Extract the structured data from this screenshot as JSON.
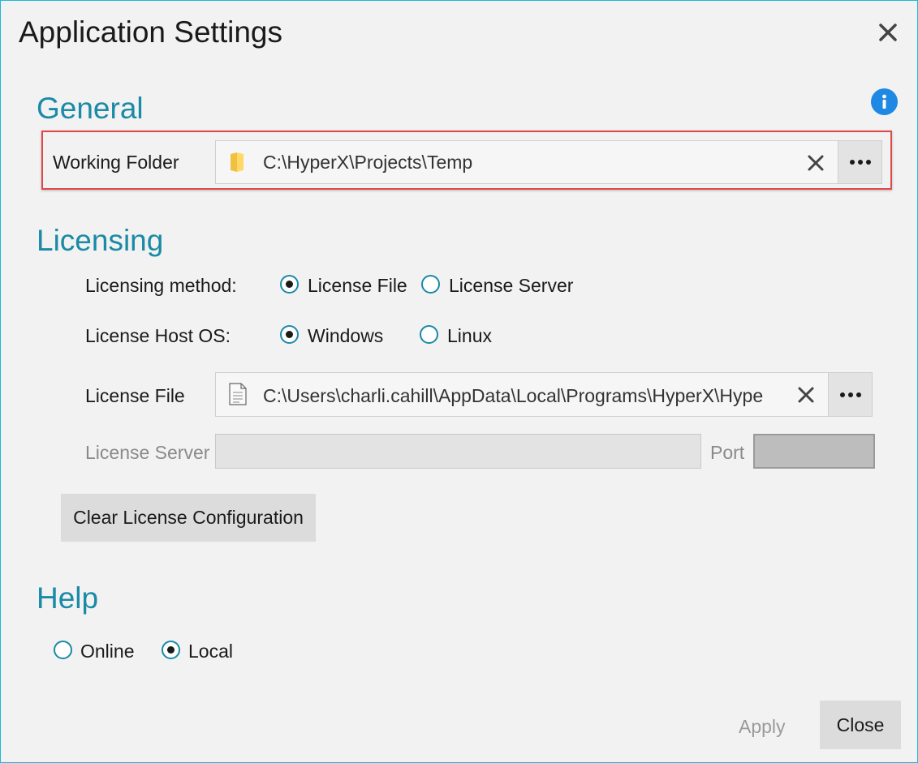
{
  "window": {
    "title": "Application Settings"
  },
  "general": {
    "heading": "General",
    "working_folder": {
      "label": "Working Folder",
      "value": "C:\\HyperX\\Projects\\Temp"
    }
  },
  "licensing": {
    "heading": "Licensing",
    "method": {
      "label": "Licensing method:",
      "options": [
        {
          "label": "License File",
          "selected": true
        },
        {
          "label": "License Server",
          "selected": false
        }
      ]
    },
    "host_os": {
      "label": "License Host OS:",
      "options": [
        {
          "label": "Windows",
          "selected": true
        },
        {
          "label": "Linux",
          "selected": false
        }
      ]
    },
    "license_file": {
      "label": "License File",
      "value": "C:\\Users\\charli.cahill\\AppData\\Local\\Programs\\HyperX\\Hype"
    },
    "license_server": {
      "label": "License Server",
      "value": ""
    },
    "port": {
      "label": "Port",
      "value": ""
    },
    "clear_button": "Clear License Configuration"
  },
  "help": {
    "heading": "Help",
    "options": [
      {
        "label": "Online",
        "selected": false
      },
      {
        "label": "Local",
        "selected": true
      }
    ]
  },
  "footer": {
    "apply_label": "Apply",
    "close_label": "Close"
  },
  "colors": {
    "accent": "#1a8aa6",
    "window_border": "#1fb8d6",
    "highlight": "#e04848",
    "info": "#1e88e5"
  },
  "icons": {
    "close": "close-icon",
    "info": "info-icon",
    "folder": "folder-icon",
    "file": "file-icon",
    "clear": "clear-icon",
    "browse": "ellipsis-icon"
  }
}
